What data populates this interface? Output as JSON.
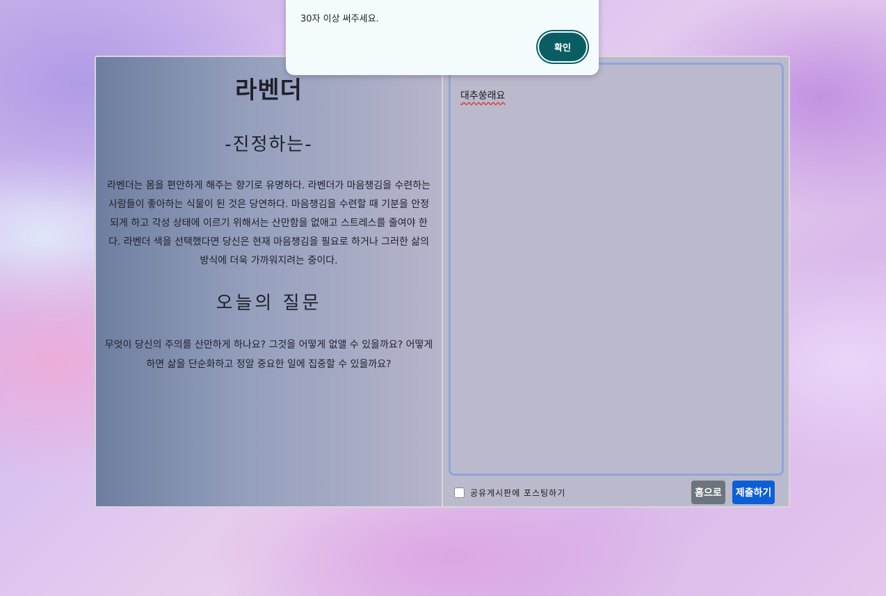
{
  "alert": {
    "message": "30자 이상 써주세요.",
    "confirm_label": "확인"
  },
  "flower": {
    "name": "라벤더",
    "meaning": "-진정하는-",
    "description": "라벤더는 몸을 편안하게 해주는 향기로 유명하다. 라벤더가 마음챙김을 수련하는 사람들이 좋아하는 식물이 된 것은 당연하다. 마음챙김을 수련할 때 기분을 안정되게 하고 각성 상태에 이르기 위해서는 산만함을 없애고 스트레스를 줄여야 한다. 라벤더 색을 선택했다면 당신은 현재 마음챙김을 필요로 하거나 그러한 삶의 방식에 더욱 가까워지려는 중이다."
  },
  "question": {
    "title": "오늘의 질문",
    "text": "무엇이 당신의 주의를 산만하게 하나요? 그것을 어떻게 없앨 수 있을까요? 어떻게 하면 삶을 단순화하고 정말 중요한 일에 집중할 수 있을까요?"
  },
  "answer": {
    "value": "대추쑹래요"
  },
  "form": {
    "share_label": "공유게시판에 포스팅하기",
    "share_checked": false,
    "home_label": "홈으로",
    "submit_label": "제출하기"
  },
  "colors": {
    "home_button": "#6c757d",
    "submit_button": "#0d5fd6",
    "confirm_button": "#0a5e63"
  }
}
